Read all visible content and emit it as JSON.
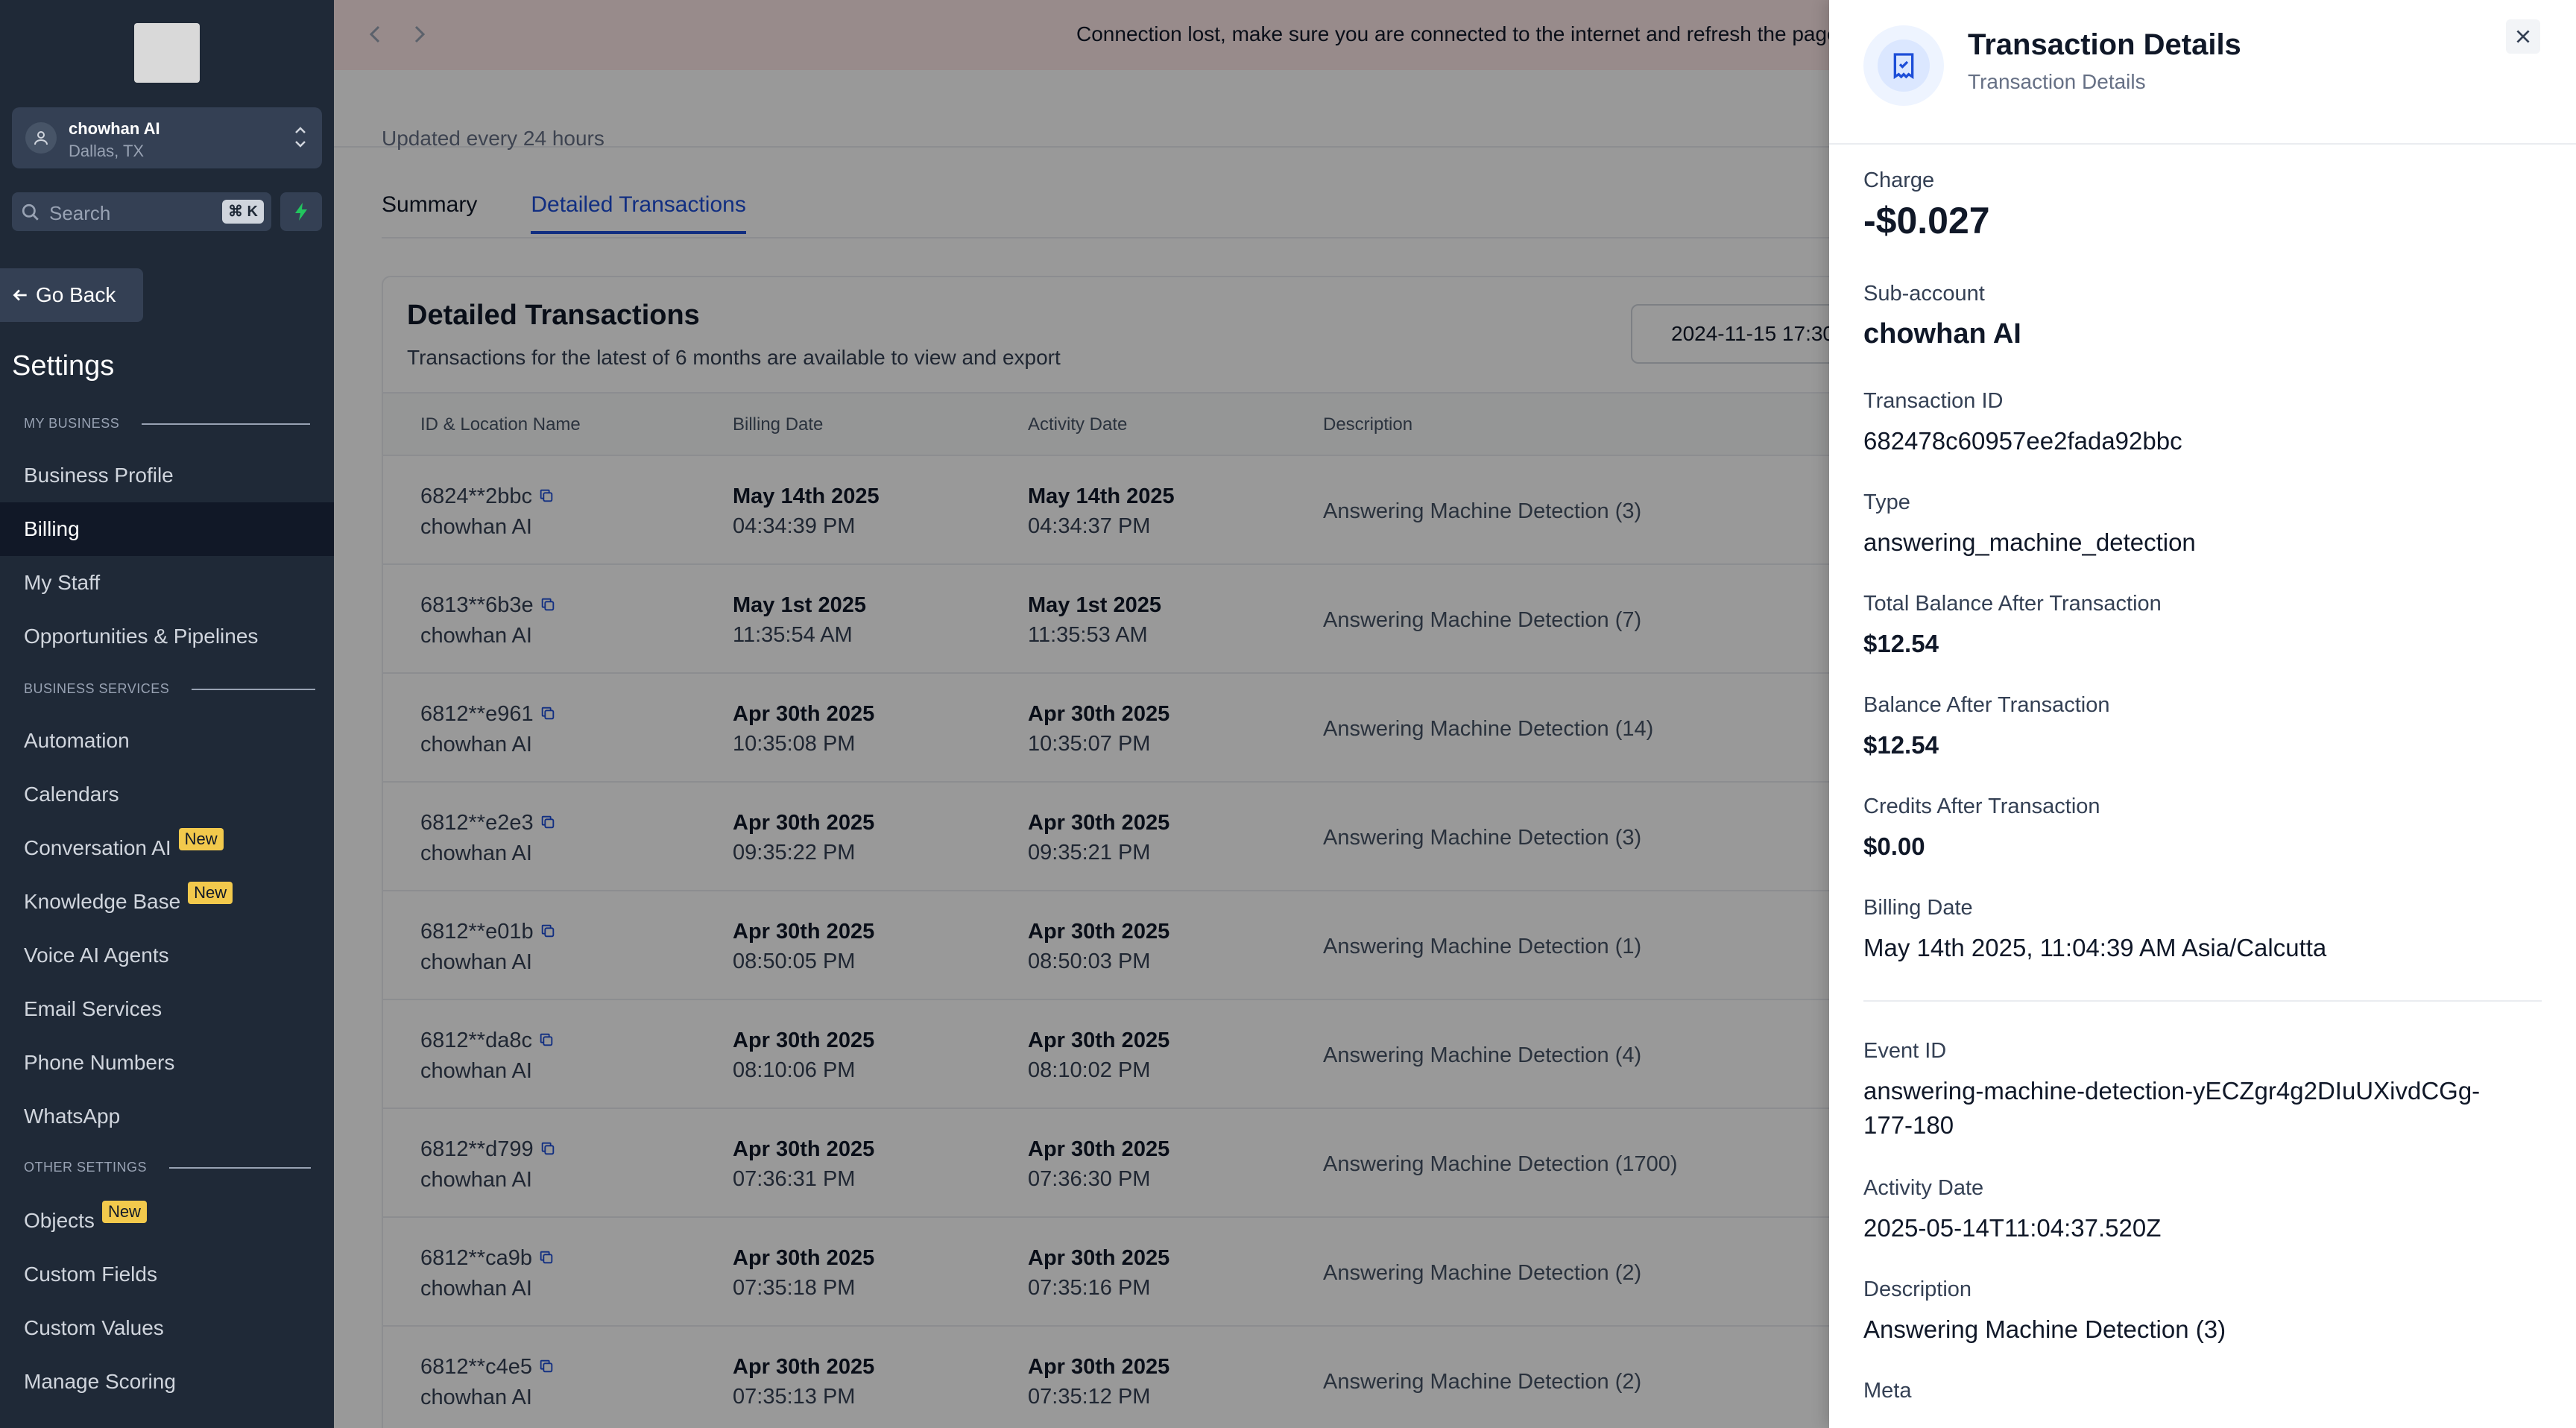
{
  "sidebar": {
    "account": {
      "name": "chowhan AI",
      "location": "Dallas, TX"
    },
    "search": {
      "placeholder": "Search",
      "shortcut": "⌘ K"
    },
    "go_back": "Go Back",
    "title": "Settings",
    "sections": {
      "my_business": "MY BUSINESS",
      "business_services": "BUSINESS SERVICES",
      "other_settings": "OTHER SETTINGS"
    },
    "items": {
      "business_profile": "Business Profile",
      "billing": "Billing",
      "my_staff": "My Staff",
      "opportunities": "Opportunities & Pipelines",
      "automation": "Automation",
      "calendars": "Calendars",
      "conversation_ai": "Conversation AI",
      "knowledge_base": "Knowledge Base",
      "voice_ai": "Voice AI Agents",
      "email_services": "Email Services",
      "phone_numbers": "Phone Numbers",
      "whatsapp": "WhatsApp",
      "objects": "Objects",
      "custom_fields": "Custom Fields",
      "custom_values": "Custom Values",
      "manage_scoring": "Manage Scoring"
    },
    "badge_new": "New"
  },
  "banner": {
    "message": "Connection lost, make sure you are connected to the internet and refresh the page"
  },
  "main": {
    "updated_note": "Updated every 24 hours",
    "tabs": {
      "summary": "Summary",
      "detailed": "Detailed Transactions"
    },
    "card": {
      "title": "Detailed Transactions",
      "subtitle": "Transactions for the latest of 6 months are available to view and export",
      "date_range": "2024-11-15 17:30"
    },
    "columns": {
      "id": "ID & Location Name",
      "billing": "Billing Date",
      "activity": "Activity Date",
      "description": "Description"
    },
    "rows": [
      {
        "id": "6824**2bbc",
        "loc": "chowhan AI",
        "bdate": "May 14th 2025",
        "btime": "04:34:39 PM",
        "adate": "May 14th 2025",
        "atime": "04:34:37 PM",
        "desc": "Answering Machine Detection (3)"
      },
      {
        "id": "6813**6b3e",
        "loc": "chowhan AI",
        "bdate": "May 1st 2025",
        "btime": "11:35:54 AM",
        "adate": "May 1st 2025",
        "atime": "11:35:53 AM",
        "desc": "Answering Machine Detection (7)"
      },
      {
        "id": "6812**e961",
        "loc": "chowhan AI",
        "bdate": "Apr 30th 2025",
        "btime": "10:35:08 PM",
        "adate": "Apr 30th 2025",
        "atime": "10:35:07 PM",
        "desc": "Answering Machine Detection (14)"
      },
      {
        "id": "6812**e2e3",
        "loc": "chowhan AI",
        "bdate": "Apr 30th 2025",
        "btime": "09:35:22 PM",
        "adate": "Apr 30th 2025",
        "atime": "09:35:21 PM",
        "desc": "Answering Machine Detection (3)"
      },
      {
        "id": "6812**e01b",
        "loc": "chowhan AI",
        "bdate": "Apr 30th 2025",
        "btime": "08:50:05 PM",
        "adate": "Apr 30th 2025",
        "atime": "08:50:03 PM",
        "desc": "Answering Machine Detection (1)"
      },
      {
        "id": "6812**da8c",
        "loc": "chowhan AI",
        "bdate": "Apr 30th 2025",
        "btime": "08:10:06 PM",
        "adate": "Apr 30th 2025",
        "atime": "08:10:02 PM",
        "desc": "Answering Machine Detection (4)"
      },
      {
        "id": "6812**d799",
        "loc": "chowhan AI",
        "bdate": "Apr 30th 2025",
        "btime": "07:36:31 PM",
        "adate": "Apr 30th 2025",
        "atime": "07:36:30 PM",
        "desc": "Answering Machine Detection (1700)"
      },
      {
        "id": "6812**ca9b",
        "loc": "chowhan AI",
        "bdate": "Apr 30th 2025",
        "btime": "07:35:18 PM",
        "adate": "Apr 30th 2025",
        "atime": "07:35:16 PM",
        "desc": "Answering Machine Detection (2)"
      },
      {
        "id": "6812**c4e5",
        "loc": "chowhan AI",
        "bdate": "Apr 30th 2025",
        "btime": "07:35:13 PM",
        "adate": "Apr 30th 2025",
        "atime": "07:35:12 PM",
        "desc": "Answering Machine Detection (2)"
      }
    ]
  },
  "drawer": {
    "title": "Transaction Details",
    "subtitle": "Transaction Details",
    "fields": {
      "charge_label": "Charge",
      "charge": "-$0.027",
      "subaccount_label": "Sub-account",
      "subaccount": "chowhan AI",
      "txid_label": "Transaction ID",
      "txid": "682478c60957ee2fada92bbc",
      "type_label": "Type",
      "type": "answering_machine_detection",
      "total_label": "Total Balance After Transaction",
      "total": "$12.54",
      "balance_label": "Balance After Transaction",
      "balance": "$12.54",
      "credits_label": "Credits After Transaction",
      "credits": "$0.00",
      "billing_label": "Billing Date",
      "billing": "May 14th 2025, 11:04:39 AM Asia/Calcutta",
      "event_label": "Event ID",
      "event_line1": "answering-machine-detection-yECZgr4g2DIuUXivdCGg-",
      "event_line2": "177-180",
      "activity_label": "Activity Date",
      "activity": "2025-05-14T11:04:37.520Z",
      "desc_label": "Description",
      "desc": "Answering Machine Detection (3)",
      "meta_label": "Meta"
    }
  }
}
